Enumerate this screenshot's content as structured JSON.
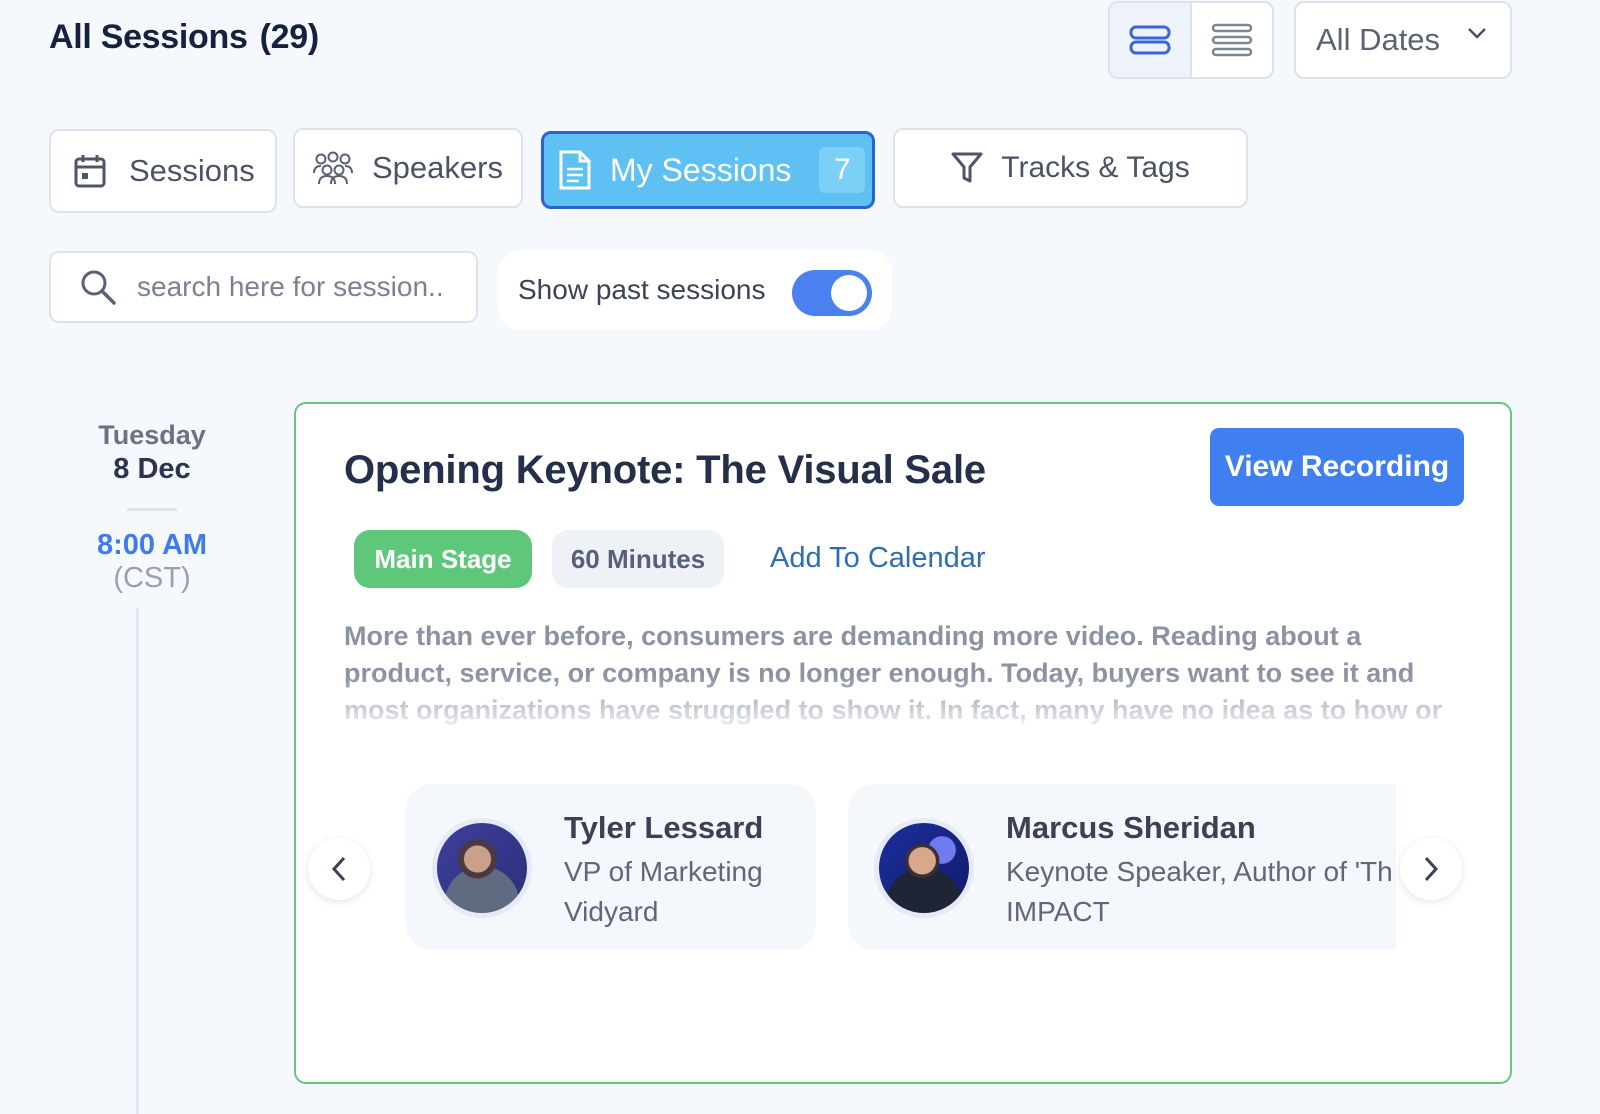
{
  "header": {
    "title": "All Sessions",
    "count": "(29)",
    "date_filter": "All Dates"
  },
  "tabs": [
    {
      "label": "Sessions",
      "icon": "calendar-icon"
    },
    {
      "label": "Speakers",
      "icon": "people-icon"
    },
    {
      "label": "My Sessions",
      "icon": "document-icon",
      "count": "7",
      "active": true
    },
    {
      "label": "Tracks & Tags",
      "icon": "filter-icon"
    }
  ],
  "search": {
    "placeholder": "search here for session.."
  },
  "past_toggle": {
    "label": "Show past sessions",
    "on": true
  },
  "timeline": {
    "day_name": "Tuesday",
    "date": "8 Dec",
    "time": "8:00 AM",
    "timezone": "(CST)"
  },
  "session": {
    "title": "Opening Keynote: The Visual Sale",
    "recording_label": "View Recording",
    "track": "Main Stage",
    "duration": "60 Minutes",
    "calendar_label": "Add To Calendar",
    "description": "More than ever before, consumers are demanding more video. Reading about a product, service, or company is no longer enough. Today, buyers want to see it and most organizations have struggled to show it. In fact, many have no idea as to how or",
    "speakers": [
      {
        "name": "Tyler Lessard",
        "role": "VP of Marketing",
        "company": "Vidyard"
      },
      {
        "name": "Marcus Sheridan",
        "role": "Keynote Speaker, Author of 'Th",
        "company": "IMPACT"
      }
    ]
  },
  "colors": {
    "accent": "#3f7ff0",
    "active_tab": "#5fc0f4",
    "track_green": "#5fc77a",
    "card_border": "#68c580"
  }
}
